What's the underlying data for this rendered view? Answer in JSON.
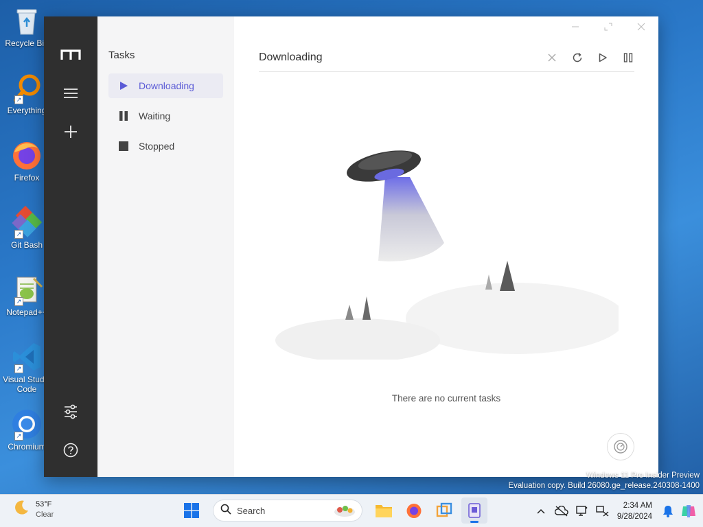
{
  "desktop": {
    "icons": [
      {
        "label": "Recycle Bin",
        "icon": "recycle-bin-icon"
      },
      {
        "label": "Everything",
        "icon": "everything-icon"
      },
      {
        "label": "Firefox",
        "icon": "firefox-icon"
      },
      {
        "label": "Git Bash",
        "icon": "git-bash-icon"
      },
      {
        "label": "Notepad++",
        "icon": "notepad-plus-plus-icon"
      },
      {
        "label": "Visual Studio",
        "label2": "Code",
        "icon": "vscode-icon"
      },
      {
        "label": "Chromium",
        "icon": "chromium-icon"
      }
    ],
    "watermark_line1": "Windows 11 Pro Insider Preview",
    "watermark_line2": "Evaluation copy. Build 26080.ge_release.240308-1400"
  },
  "app": {
    "sidebar": {
      "logo": "motrix-logo-icon",
      "menu": "menu-icon",
      "add": "plus-icon",
      "preferences": "sliders-icon",
      "help": "help-icon"
    },
    "task_panel": {
      "title": "Tasks",
      "items": [
        {
          "label": "Downloading",
          "icon": "play-icon",
          "active": true
        },
        {
          "label": "Waiting",
          "icon": "pause-icon",
          "active": false
        },
        {
          "label": "Stopped",
          "icon": "stop-icon",
          "active": false
        }
      ]
    },
    "main": {
      "title": "Downloading",
      "actions": [
        "close-icon",
        "refresh-icon",
        "play-icon",
        "pause-icon"
      ],
      "empty_message": "There are no current tasks",
      "speed_button": "speedometer-icon"
    },
    "window_controls": [
      "minimize-icon",
      "maximize-icon",
      "close-icon"
    ],
    "colors": {
      "accent": "#5b5bd6",
      "sidebar": "#2f2f2f",
      "panel": "#f5f5f6"
    }
  },
  "taskbar": {
    "weather": {
      "temp": "53°F",
      "condition": "Clear"
    },
    "search_placeholder": "Search",
    "clock": {
      "time": "2:34 AM",
      "date": "9/28/2024"
    }
  }
}
